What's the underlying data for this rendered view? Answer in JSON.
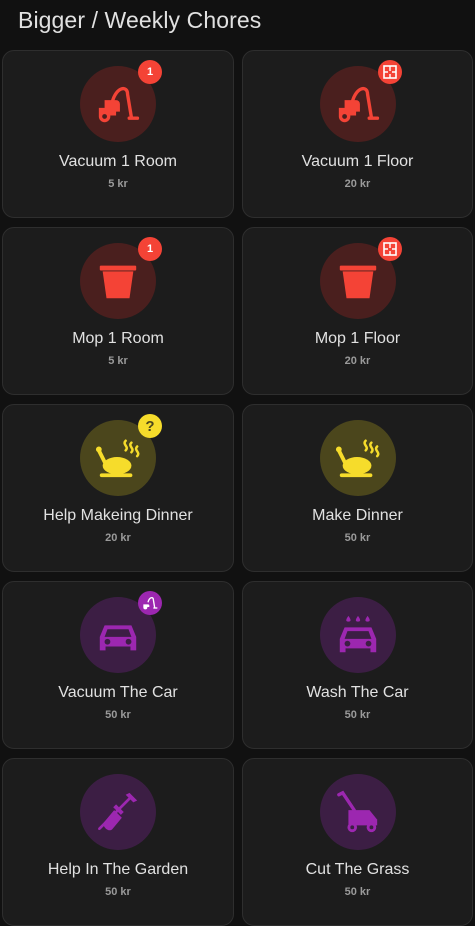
{
  "header": {
    "title": "Bigger / Weekly Chores"
  },
  "colors": {
    "red": "#f44336",
    "yellow": "#f6dc2b",
    "purple": "#9c27b0"
  },
  "chores": [
    {
      "title": "Vacuum 1 Room",
      "price": "5 kr",
      "icon": "vacuum-icon",
      "badge": "1"
    },
    {
      "title": "Vacuum 1 Floor",
      "price": "20 kr",
      "icon": "vacuum-icon",
      "badge_icon": "floor-plan-icon"
    },
    {
      "title": "Mop 1 Room",
      "price": "5 kr",
      "icon": "bucket-icon",
      "badge": "1"
    },
    {
      "title": "Mop 1 Floor",
      "price": "20 kr",
      "icon": "bucket-icon",
      "badge_icon": "floor-plan-icon"
    },
    {
      "title": "Help Makeing Dinner",
      "price": "20 kr",
      "icon": "food-turkey-icon",
      "badge": "?"
    },
    {
      "title": "Make Dinner",
      "price": "50 kr",
      "icon": "food-turkey-icon"
    },
    {
      "title": "Vacuum The Car",
      "price": "50 kr",
      "icon": "car-icon",
      "badge_icon": "vacuum-icon"
    },
    {
      "title": "Wash The Car",
      "price": "50 kr",
      "icon": "car-wash-icon"
    },
    {
      "title": "Help In The Garden",
      "price": "50 kr",
      "icon": "shovel-icon"
    },
    {
      "title": "Cut The Grass",
      "price": "50 kr",
      "icon": "lawn-mower-icon"
    }
  ]
}
